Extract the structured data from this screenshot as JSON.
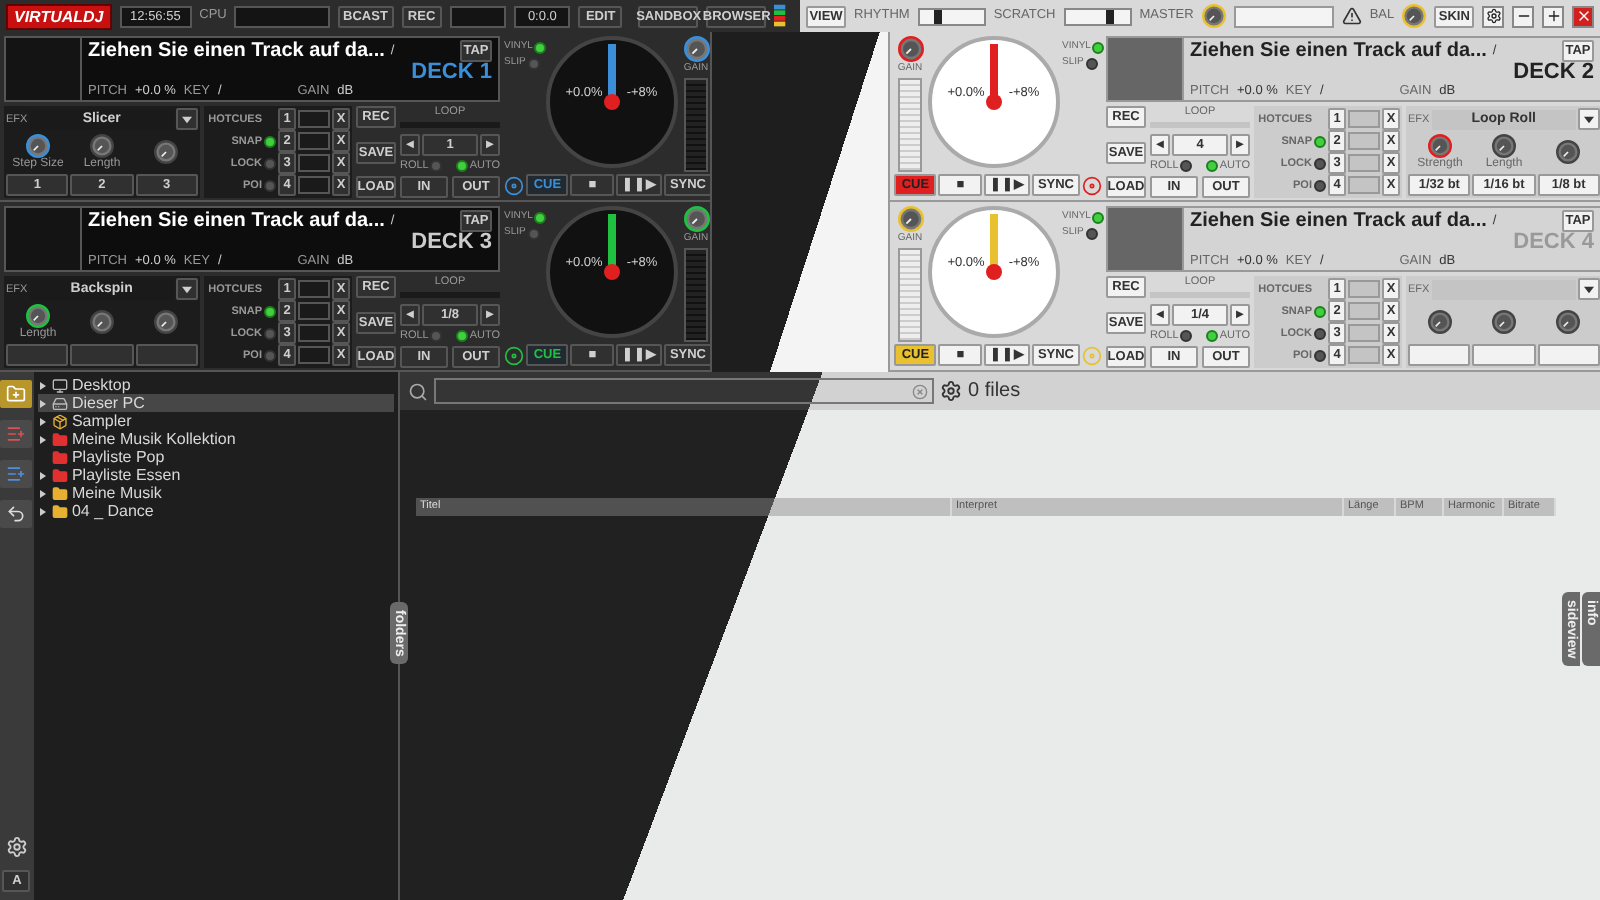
{
  "top_bar": {
    "logo": "VIRTUALDJ",
    "clock": "12:56:55",
    "cpu_label": "CPU",
    "bcast": "BCAST",
    "rec": "REC",
    "time": "0:0.0",
    "edit": "EDIT",
    "sandbox": "SANDBOX",
    "browser": "BROWSER",
    "view": "VIEW",
    "rhythm": {
      "label": "RHYTHM",
      "level": 0.3
    },
    "scratch": {
      "label": "SCRATCH",
      "level": 0.7
    },
    "master": "MASTER",
    "bal": "BAL",
    "skin": "SKIN"
  },
  "decks": [
    {
      "name": "DECK 1",
      "active": true,
      "color": "#3a8fd8",
      "title": "Ziehen Sie einen Track auf da...",
      "slash": "/",
      "tap": "TAP",
      "pitch_label": "PITCH",
      "pitch": "+0.0 %",
      "key_label": "KEY",
      "key": "/",
      "gain_label": "GAIN",
      "gain": "dB",
      "efx": {
        "label": "EFX",
        "name": "Slicer",
        "knobs": [
          "Step Size",
          "Length"
        ],
        "buttons": [
          "1",
          "2",
          "3"
        ]
      },
      "hotcues": [
        {
          "kind": "title",
          "label": "HOTCUES",
          "num": "1",
          "clear": "X"
        },
        {
          "kind": "toggle",
          "label": "SNAP",
          "on": true,
          "num": "2",
          "clear": "X"
        },
        {
          "kind": "toggle",
          "label": "LOCK",
          "on": false,
          "num": "3",
          "clear": "X"
        },
        {
          "kind": "toggle",
          "label": "POI",
          "on": false,
          "num": "4",
          "clear": "X"
        }
      ],
      "loop": {
        "rec": "REC",
        "save": "SAVE",
        "load": "LOAD",
        "label": "LOOP",
        "prev": "◄",
        "value": "1",
        "next": "►",
        "roll": {
          "label": "ROLL",
          "on": false
        },
        "auto": {
          "label": "AUTO",
          "on": true
        },
        "in": "IN",
        "out": "OUT"
      },
      "vinyl": {
        "label": "VINYL",
        "on": true
      },
      "slip": {
        "label": "SLIP",
        "on": false
      },
      "platter": {
        "pitch": "+0.0%",
        "range": "-+8%"
      },
      "gain_knob": "GAIN",
      "transport": {
        "cue": "CUE",
        "stop": "■",
        "play": "❚❚▶",
        "sync": "SYNC"
      }
    },
    {
      "name": "DECK 2",
      "active": true,
      "color": "#e02020",
      "title": "Ziehen Sie einen Track auf da...",
      "slash": "/",
      "tap": "TAP",
      "pitch_label": "PITCH",
      "pitch": "+0.0 %",
      "key_label": "KEY",
      "key": "/",
      "gain_label": "GAIN",
      "gain": "dB",
      "efx": {
        "label": "EFX",
        "name": "Loop Roll",
        "knobs": [
          "Strength",
          "Length"
        ],
        "buttons": [
          "1/32 bt",
          "1/16 bt",
          "1/8 bt"
        ]
      },
      "hotcues": [
        {
          "kind": "title",
          "label": "HOTCUES",
          "num": "1",
          "clear": "X"
        },
        {
          "kind": "toggle",
          "label": "SNAP",
          "on": true,
          "num": "2",
          "clear": "X"
        },
        {
          "kind": "toggle",
          "label": "LOCK",
          "on": false,
          "num": "3",
          "clear": "X"
        },
        {
          "kind": "toggle",
          "label": "POI",
          "on": false,
          "num": "4",
          "clear": "X"
        }
      ],
      "loop": {
        "rec": "REC",
        "save": "SAVE",
        "load": "LOAD",
        "label": "LOOP",
        "prev": "◄",
        "value": "4",
        "next": "►",
        "roll": {
          "label": "ROLL",
          "on": false
        },
        "auto": {
          "label": "AUTO",
          "on": true
        },
        "in": "IN",
        "out": "OUT"
      },
      "vinyl": {
        "label": "VINYL",
        "on": true
      },
      "slip": {
        "label": "SLIP",
        "on": false
      },
      "platter": {
        "pitch": "+0.0%",
        "range": "-+8%"
      },
      "gain_knob": "GAIN",
      "transport": {
        "cue": "CUE",
        "stop": "■",
        "play": "❚❚▶",
        "sync": "SYNC"
      }
    },
    {
      "name": "DECK 3",
      "active": false,
      "color": "#20c040",
      "title": "Ziehen Sie einen Track auf da...",
      "slash": "/",
      "tap": "TAP",
      "pitch_label": "PITCH",
      "pitch": "+0.0 %",
      "key_label": "KEY",
      "key": "/",
      "gain_label": "GAIN",
      "gain": "dB",
      "efx": {
        "label": "EFX",
        "name": "Backspin",
        "knobs": [
          "Length"
        ]
      },
      "hotcues": [
        {
          "kind": "title",
          "label": "HOTCUES",
          "num": "1",
          "clear": "X"
        },
        {
          "kind": "toggle",
          "label": "SNAP",
          "on": true,
          "num": "2",
          "clear": "X"
        },
        {
          "kind": "toggle",
          "label": "LOCK",
          "on": false,
          "num": "3",
          "clear": "X"
        },
        {
          "kind": "toggle",
          "label": "POI",
          "on": false,
          "num": "4",
          "clear": "X"
        }
      ],
      "loop": {
        "rec": "REC",
        "save": "SAVE",
        "load": "LOAD",
        "label": "LOOP",
        "prev": "◄",
        "value": "1/8",
        "next": "►",
        "roll": {
          "label": "ROLL",
          "on": false
        },
        "auto": {
          "label": "AUTO",
          "on": true
        },
        "in": "IN",
        "out": "OUT"
      },
      "vinyl": {
        "label": "VINYL",
        "on": true
      },
      "slip": {
        "label": "SLIP",
        "on": false
      },
      "platter": {
        "pitch": "+0.0%",
        "range": "-+8%"
      },
      "gain_knob": "GAIN",
      "transport": {
        "cue": "CUE",
        "stop": "■",
        "play": "❚❚▶",
        "sync": "SYNC"
      }
    },
    {
      "name": "DECK 4",
      "active": false,
      "color": "#e8c030",
      "title": "Ziehen Sie einen Track auf da...",
      "slash": "/",
      "tap": "TAP",
      "pitch_label": "PITCH",
      "pitch": "+0.0 %",
      "key_label": "KEY",
      "key": "/",
      "gain_label": "GAIN",
      "gain": "dB",
      "efx": {
        "label": "EFX"
      },
      "hotcues": [
        {
          "kind": "title",
          "label": "HOTCUES",
          "num": "1",
          "clear": "X"
        },
        {
          "kind": "toggle",
          "label": "SNAP",
          "on": true,
          "num": "2",
          "clear": "X"
        },
        {
          "kind": "toggle",
          "label": "LOCK",
          "on": false,
          "num": "3",
          "clear": "X"
        },
        {
          "kind": "toggle",
          "label": "POI",
          "on": false,
          "num": "4",
          "clear": "X"
        }
      ],
      "loop": {
        "rec": "REC",
        "save": "SAVE",
        "load": "LOAD",
        "label": "LOOP",
        "prev": "◄",
        "value": "1/4",
        "next": "►",
        "roll": {
          "label": "ROLL",
          "on": false
        },
        "auto": {
          "label": "AUTO",
          "on": true
        },
        "in": "IN",
        "out": "OUT"
      },
      "vinyl": {
        "label": "VINYL",
        "on": true
      },
      "slip": {
        "label": "SLIP",
        "on": false
      },
      "platter": {
        "pitch": "+0.0%",
        "range": "-+8%"
      },
      "gain_knob": "GAIN",
      "transport": {
        "cue": "CUE",
        "stop": "■",
        "play": "❚❚▶",
        "sync": "SYNC"
      }
    }
  ],
  "browser": {
    "font_button": "A",
    "tree": [
      {
        "label": "Desktop",
        "kind": "desktop",
        "expandable": true,
        "selected": false
      },
      {
        "label": "Dieser PC",
        "kind": "computer",
        "expandable": true,
        "selected": true
      },
      {
        "label": "Sampler",
        "kind": "sampler",
        "expandable": true,
        "selected": false
      },
      {
        "label": "Meine Musik Kollektion",
        "kind": "playlist",
        "expandable": true,
        "selected": false
      },
      {
        "label": "Playliste Pop",
        "kind": "playlist",
        "expandable": false,
        "selected": false
      },
      {
        "label": "Playliste Essen",
        "kind": "playlist",
        "expandable": true,
        "selected": false
      },
      {
        "label": "Meine Musik",
        "kind": "folder",
        "expandable": true,
        "selected": false
      },
      {
        "label": "04 _ Dance",
        "kind": "folder",
        "expandable": true,
        "selected": false
      }
    ],
    "folders_tab": "folders",
    "files": "0 files",
    "columns": [
      "Titel",
      "Interpret",
      "Länge",
      "BPM",
      "Harmonic",
      "Bitrate"
    ],
    "side_tabs": [
      "sideview",
      "info"
    ]
  }
}
